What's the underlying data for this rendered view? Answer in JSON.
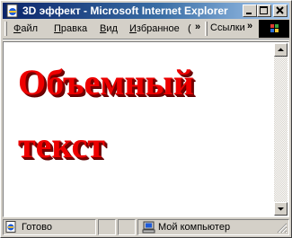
{
  "window": {
    "title": "3D эффект - Microsoft Internet Explorer"
  },
  "menu": {
    "file": "Файл",
    "file_key": "Ф",
    "edit": "Правка",
    "edit_key": "П",
    "view": "Вид",
    "view_key": "В",
    "favorites": "Избранное",
    "favorites_key": "И",
    "tools_partial": "(",
    "more_chevron": "»"
  },
  "links_bar": {
    "label": "Ссылки",
    "more_chevron": "»"
  },
  "content": {
    "line1": "Объемный",
    "line2": "текст",
    "text_color": "#ee0000",
    "shadow_color": "#7a0000"
  },
  "status": {
    "left_text": "Готово",
    "zone_text": "Мой компьютер"
  },
  "icons": {
    "app": "ie-page-icon",
    "minimize": "minimize-icon",
    "maximize": "maximize-icon",
    "close": "close-icon",
    "status_page": "ie-page-status-icon",
    "zone": "my-computer-icon"
  }
}
